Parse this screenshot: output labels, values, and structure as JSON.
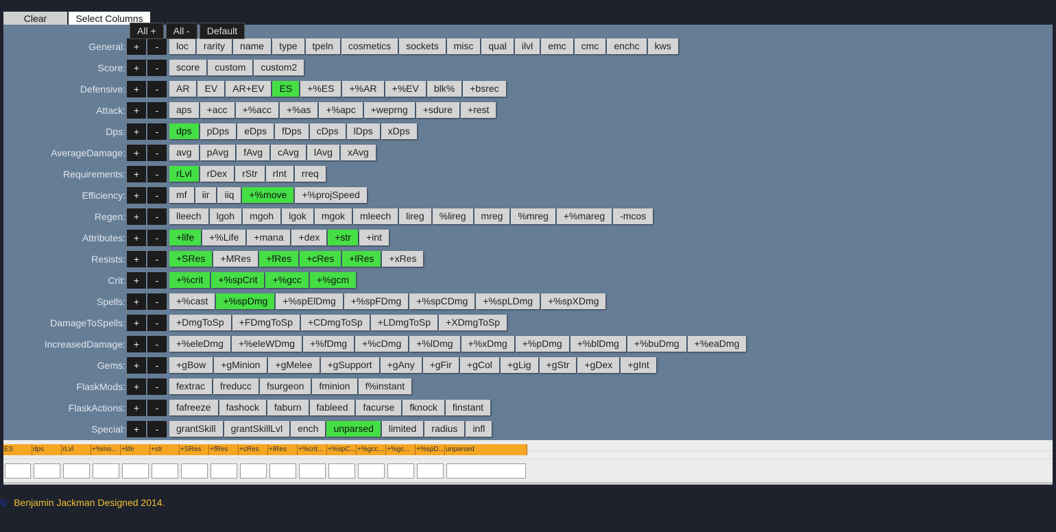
{
  "toolbar": {
    "clear_filters": "Clear Filters",
    "select_columns": "Select Columns"
  },
  "all_controls": {
    "all_plus": "All +",
    "all_minus": "All -",
    "default": "Default"
  },
  "row_buttons": {
    "plus": "+",
    "minus": "-"
  },
  "categories": [
    {
      "label": "General:",
      "items": [
        [
          "loc",
          0
        ],
        [
          "rarity",
          0
        ],
        [
          "name",
          0
        ],
        [
          "type",
          0
        ],
        [
          "tpeln",
          0
        ],
        [
          "cosmetics",
          0
        ],
        [
          "sockets",
          0
        ],
        [
          "misc",
          0
        ],
        [
          "qual",
          0
        ],
        [
          "ilvl",
          0
        ],
        [
          "emc",
          0
        ],
        [
          "cmc",
          0
        ],
        [
          "enchc",
          0
        ],
        [
          "kws",
          0
        ]
      ]
    },
    {
      "label": "Score:",
      "items": [
        [
          "score",
          0
        ],
        [
          "custom",
          0
        ],
        [
          "custom2",
          0
        ]
      ]
    },
    {
      "label": "Defensive:",
      "items": [
        [
          "AR",
          0
        ],
        [
          "EV",
          0
        ],
        [
          "AR+EV",
          0
        ],
        [
          "ES",
          1
        ],
        [
          "+%ES",
          0
        ],
        [
          "+%AR",
          0
        ],
        [
          "+%EV",
          0
        ],
        [
          "blk%",
          0
        ],
        [
          "+bsrec",
          0
        ]
      ]
    },
    {
      "label": "Attack:",
      "items": [
        [
          "aps",
          0
        ],
        [
          "+acc",
          0
        ],
        [
          "+%acc",
          0
        ],
        [
          "+%as",
          0
        ],
        [
          "+%apc",
          0
        ],
        [
          "+weprng",
          0
        ],
        [
          "+sdure",
          0
        ],
        [
          "+rest",
          0
        ]
      ]
    },
    {
      "label": "Dps:",
      "items": [
        [
          "dps",
          1
        ],
        [
          "pDps",
          0
        ],
        [
          "eDps",
          0
        ],
        [
          "fDps",
          0
        ],
        [
          "cDps",
          0
        ],
        [
          "lDps",
          0
        ],
        [
          "xDps",
          0
        ]
      ]
    },
    {
      "label": "AverageDamage:",
      "items": [
        [
          "avg",
          0
        ],
        [
          "pAvg",
          0
        ],
        [
          "fAvg",
          0
        ],
        [
          "cAvg",
          0
        ],
        [
          "lAvg",
          0
        ],
        [
          "xAvg",
          0
        ]
      ]
    },
    {
      "label": "Requirements:",
      "items": [
        [
          "rLvl",
          1
        ],
        [
          "rDex",
          0
        ],
        [
          "rStr",
          0
        ],
        [
          "rInt",
          0
        ],
        [
          "rreq",
          0
        ]
      ]
    },
    {
      "label": "Efficiency:",
      "items": [
        [
          "mf",
          0
        ],
        [
          "iir",
          0
        ],
        [
          "iiq",
          0
        ],
        [
          "+%move",
          1
        ],
        [
          "+%projSpeed",
          0
        ]
      ]
    },
    {
      "label": "Regen:",
      "items": [
        [
          "lleech",
          0
        ],
        [
          "lgoh",
          0
        ],
        [
          "mgoh",
          0
        ],
        [
          "lgok",
          0
        ],
        [
          "mgok",
          0
        ],
        [
          "mleech",
          0
        ],
        [
          "lireg",
          0
        ],
        [
          "%lireg",
          0
        ],
        [
          "mreg",
          0
        ],
        [
          "%mreg",
          0
        ],
        [
          "+%mareg",
          0
        ],
        [
          "-mcos",
          0
        ]
      ]
    },
    {
      "label": "Attributes:",
      "items": [
        [
          "+life",
          1
        ],
        [
          "+%Life",
          0
        ],
        [
          "+mana",
          0
        ],
        [
          "+dex",
          0
        ],
        [
          "+str",
          1
        ],
        [
          "+int",
          0
        ]
      ]
    },
    {
      "label": "Resists:",
      "items": [
        [
          "+SRes",
          1
        ],
        [
          "+MRes",
          0
        ],
        [
          "+fRes",
          1
        ],
        [
          "+cRes",
          1
        ],
        [
          "+lRes",
          1
        ],
        [
          "+xRes",
          0
        ]
      ]
    },
    {
      "label": "Crit:",
      "items": [
        [
          "+%crit",
          1
        ],
        [
          "+%spCrit",
          1
        ],
        [
          "+%gcc",
          1
        ],
        [
          "+%gcm",
          1
        ]
      ]
    },
    {
      "label": "Spells:",
      "items": [
        [
          "+%cast",
          0
        ],
        [
          "+%spDmg",
          1
        ],
        [
          "+%spElDmg",
          0
        ],
        [
          "+%spFDmg",
          0
        ],
        [
          "+%spCDmg",
          0
        ],
        [
          "+%spLDmg",
          0
        ],
        [
          "+%spXDmg",
          0
        ]
      ]
    },
    {
      "label": "DamageToSpells:",
      "items": [
        [
          "+DmgToSp",
          0
        ],
        [
          "+FDmgToSp",
          0
        ],
        [
          "+CDmgToSp",
          0
        ],
        [
          "+LDmgToSp",
          0
        ],
        [
          "+XDmgToSp",
          0
        ]
      ]
    },
    {
      "label": "IncreasedDamage:",
      "items": [
        [
          "+%eleDmg",
          0
        ],
        [
          "+%eleWDmg",
          0
        ],
        [
          "+%fDmg",
          0
        ],
        [
          "+%cDmg",
          0
        ],
        [
          "+%lDmg",
          0
        ],
        [
          "+%xDmg",
          0
        ],
        [
          "+%pDmg",
          0
        ],
        [
          "+%blDmg",
          0
        ],
        [
          "+%buDmg",
          0
        ],
        [
          "+%eaDmg",
          0
        ]
      ]
    },
    {
      "label": "Gems:",
      "items": [
        [
          "+gBow",
          0
        ],
        [
          "+gMinion",
          0
        ],
        [
          "+gMelee",
          0
        ],
        [
          "+gSupport",
          0
        ],
        [
          "+gAny",
          0
        ],
        [
          "+gFir",
          0
        ],
        [
          "+gCol",
          0
        ],
        [
          "+gLig",
          0
        ],
        [
          "+gStr",
          0
        ],
        [
          "+gDex",
          0
        ],
        [
          "+gInt",
          0
        ]
      ]
    },
    {
      "label": "FlaskMods:",
      "items": [
        [
          "fextrac",
          0
        ],
        [
          "freducc",
          0
        ],
        [
          "fsurgeon",
          0
        ],
        [
          "fminion",
          0
        ],
        [
          "f%instant",
          0
        ]
      ]
    },
    {
      "label": "FlaskActions:",
      "items": [
        [
          "fafreeze",
          0
        ],
        [
          "fashock",
          0
        ],
        [
          "faburn",
          0
        ],
        [
          "fableed",
          0
        ],
        [
          "facurse",
          0
        ],
        [
          "fknock",
          0
        ],
        [
          "finstant",
          0
        ]
      ]
    },
    {
      "label": "Special:",
      "items": [
        [
          "grantSkill",
          0
        ],
        [
          "grantSkillLvl",
          0
        ],
        [
          "ench",
          0
        ],
        [
          "unparsed",
          1
        ],
        [
          "limited",
          0
        ],
        [
          "radius",
          0
        ],
        [
          "infl",
          0
        ]
      ]
    }
  ],
  "table_headers": [
    "ES",
    "dps",
    "rLvl",
    "+%mo...",
    "+life",
    "+str",
    "+SRes",
    "+fRes",
    "+cRes",
    "+lRes",
    "+%crit...",
    "+%spC...",
    "+%gcc...",
    "+%gc...",
    "+%spD...",
    "unparsed"
  ],
  "footer": {
    "copyright_icon": "©",
    "text": "Benjamin Jackman Designed 2014."
  }
}
